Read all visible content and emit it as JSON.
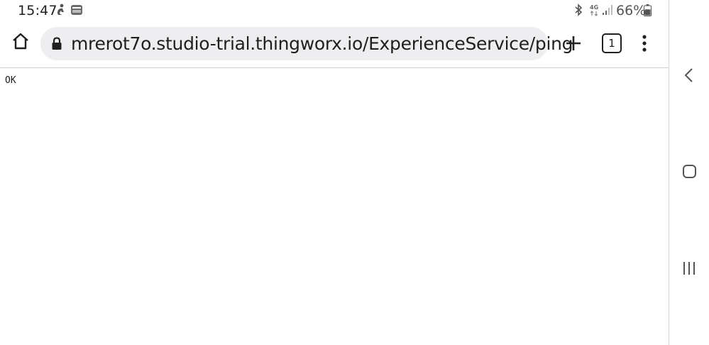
{
  "status_bar": {
    "time": "15:47",
    "notification_icons": [
      "accessibility-icon",
      "notification-card-icon"
    ],
    "system_icons": [
      "bluetooth-icon",
      "4g-icon",
      "signal-icon"
    ],
    "battery_percent": "66%",
    "battery_level": 0.66
  },
  "toolbar": {
    "home_icon": "home-icon",
    "url": "mrerot7o.studio-trial.thingworx.io/ExperienceService/ping",
    "lock_icon": "lock-icon",
    "new_tab_icon": "plus-icon",
    "tab_count": "1",
    "menu_icon": "more-vert-icon"
  },
  "page": {
    "body_text": "OK"
  },
  "nav_bar": {
    "back_icon": "back-icon",
    "home_icon": "home-circle-icon",
    "recents_icon": "recents-icon"
  },
  "colors": {
    "url_bar_bg": "#eeeef0",
    "text": "#1f1f1f",
    "divider": "#d0d0d0"
  }
}
